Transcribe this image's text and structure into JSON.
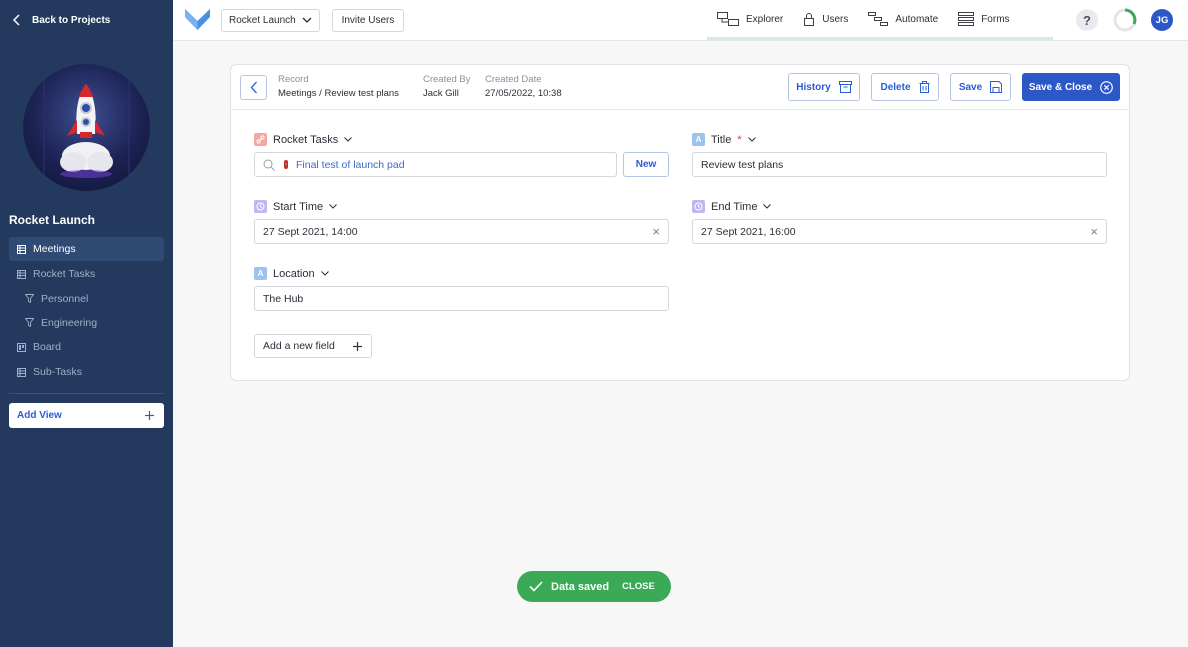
{
  "sidebar": {
    "back_label": "Back to Projects",
    "project_title": "Rocket Launch",
    "items": [
      {
        "label": "Meetings",
        "icon": "table-icon"
      },
      {
        "label": "Rocket Tasks",
        "icon": "table-icon"
      },
      {
        "label": "Personnel",
        "icon": "filter-icon"
      },
      {
        "label": "Engineering",
        "icon": "filter-icon"
      },
      {
        "label": "Board",
        "icon": "board-icon"
      },
      {
        "label": "Sub-Tasks",
        "icon": "table-icon"
      }
    ],
    "add_view_label": "Add View"
  },
  "topbar": {
    "project_select": "Rocket Launch",
    "invite_label": "Invite Users",
    "tabs": [
      {
        "label": "Explorer",
        "icon": "explorer-icon"
      },
      {
        "label": "Users",
        "icon": "lock-icon"
      },
      {
        "label": "Automate",
        "icon": "automate-icon"
      },
      {
        "label": "Forms",
        "icon": "forms-icon"
      }
    ],
    "help_label": "?",
    "user_initials": "JG"
  },
  "record": {
    "record_label": "Record",
    "record_value": "Meetings / Review test plans",
    "created_by_label": "Created By",
    "created_by_value": "Jack Gill",
    "created_date_label": "Created Date",
    "created_date_value": "27/05/2022, 10:38",
    "history_label": "History",
    "delete_label": "Delete",
    "save_label": "Save",
    "save_close_label": "Save & Close"
  },
  "fields": {
    "rocket_tasks": {
      "label": "Rocket Tasks",
      "value": "Final test of launch pad",
      "new_label": "New"
    },
    "title": {
      "label": "Title",
      "required_mark": "*",
      "value": "Review test plans",
      "icon_letter": "A"
    },
    "start_time": {
      "label": "Start Time",
      "value": "27 Sept 2021, 14:00"
    },
    "end_time": {
      "label": "End Time",
      "value": "27 Sept 2021, 16:00"
    },
    "location": {
      "label": "Location",
      "value": "The Hub",
      "icon_letter": "A"
    },
    "add_field_label": "Add a new field"
  },
  "toast": {
    "message": "Data saved",
    "close_label": "CLOSE"
  },
  "colors": {
    "sidebar_bg": "#23395d",
    "primary": "#2c57c6",
    "toast_bg": "#3aaa57"
  }
}
